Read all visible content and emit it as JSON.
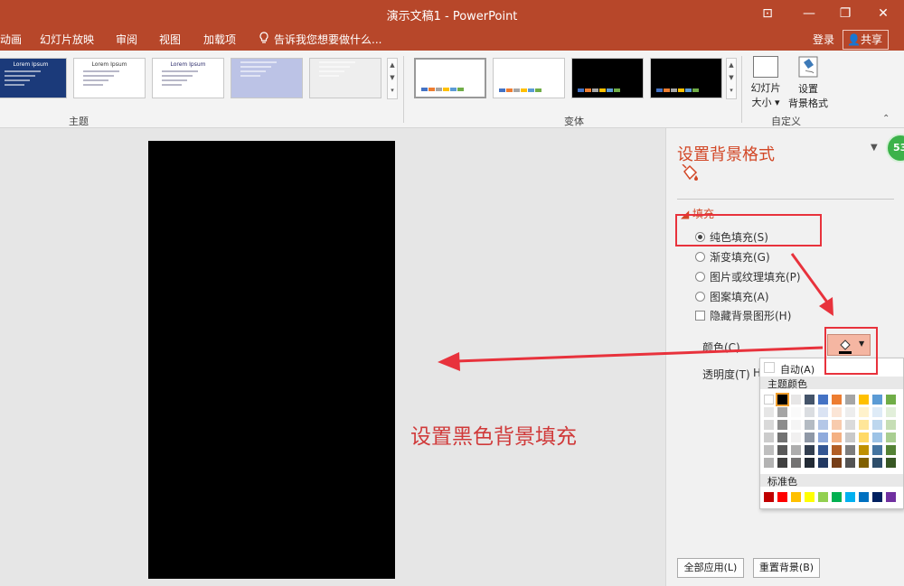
{
  "window": {
    "title": "演示文稿1 - PowerPoint",
    "min": "—",
    "restore": "❐",
    "close": "✕",
    "ribbon_toggle": "⊡"
  },
  "menu": {
    "items": [
      "动画",
      "幻灯片放映",
      "审阅",
      "视图",
      "加载项"
    ],
    "tell_me": "告诉我您想要做什么...",
    "login": "登录",
    "share": "共享"
  },
  "ribbon": {
    "theme_group_label": "主题",
    "variant_group_label": "变体",
    "custom_group_label": "自定义",
    "slide_size_label_1": "幻灯片",
    "slide_size_label_2": "大小",
    "format_bg_label_1": "设置",
    "format_bg_label_2": "背景格式",
    "theme_thumbs": [
      {
        "caption": "Lorem Ipsum",
        "bg": "#1b3a7a",
        "text": "#ffffff"
      },
      {
        "caption": "Lorem Ipsum",
        "bg": "#ffffff",
        "text": "#333333"
      },
      {
        "caption": "Lorem Ipsum",
        "bg": "#ffffff",
        "text": "#2b2b6b"
      },
      {
        "caption": "",
        "bg": "#bcc3e6",
        "text": "#333333"
      },
      {
        "caption": "",
        "bg": "#eeeeee",
        "text": "#333333"
      }
    ],
    "variants": [
      {
        "bg": "#ffffff"
      },
      {
        "bg": "#ffffff"
      },
      {
        "bg": "#000000"
      },
      {
        "bg": "#000000"
      }
    ],
    "variant_stripe": [
      "#4472c4",
      "#ed7d31",
      "#a5a5a5",
      "#ffc000",
      "#5b9bd5",
      "#70ad47"
    ]
  },
  "pane": {
    "title": "设置背景格式",
    "section": "填充",
    "options": [
      "纯色填充(S)",
      "渐变填充(G)",
      "图片或纹理填充(P)",
      "图案填充(A)"
    ],
    "selected_option": 0,
    "hide_bg_graphics": "隐藏背景图形(H)",
    "color_label": "颜色(C)",
    "transparency_label": "透明度(T)",
    "transparency_value": "H",
    "apply_all": "全部应用(L)",
    "reset_bg": "重置背景(B)",
    "badge": "53"
  },
  "palette": {
    "auto": "自动(A)",
    "theme_colors_label": "主题颜色",
    "standard_label": "标准色",
    "theme_base": [
      "#ffffff",
      "#000000",
      "#e7e6e6",
      "#44546a",
      "#4472c4",
      "#ed7d31",
      "#a5a5a5",
      "#ffc000",
      "#5b9bd5",
      "#70ad47"
    ],
    "standard": [
      "#c00000",
      "#ff0000",
      "#ffc000",
      "#ffff00",
      "#92d050",
      "#00b050",
      "#00b0f0",
      "#0070c0",
      "#002060",
      "#7030a0"
    ],
    "selected_color": "#000000"
  },
  "annotation": {
    "text": "设置黑色背景填充",
    "color": "#d03a3a"
  },
  "colors": {
    "accent": "#b7472a",
    "annotation_red": "#e8323c"
  }
}
